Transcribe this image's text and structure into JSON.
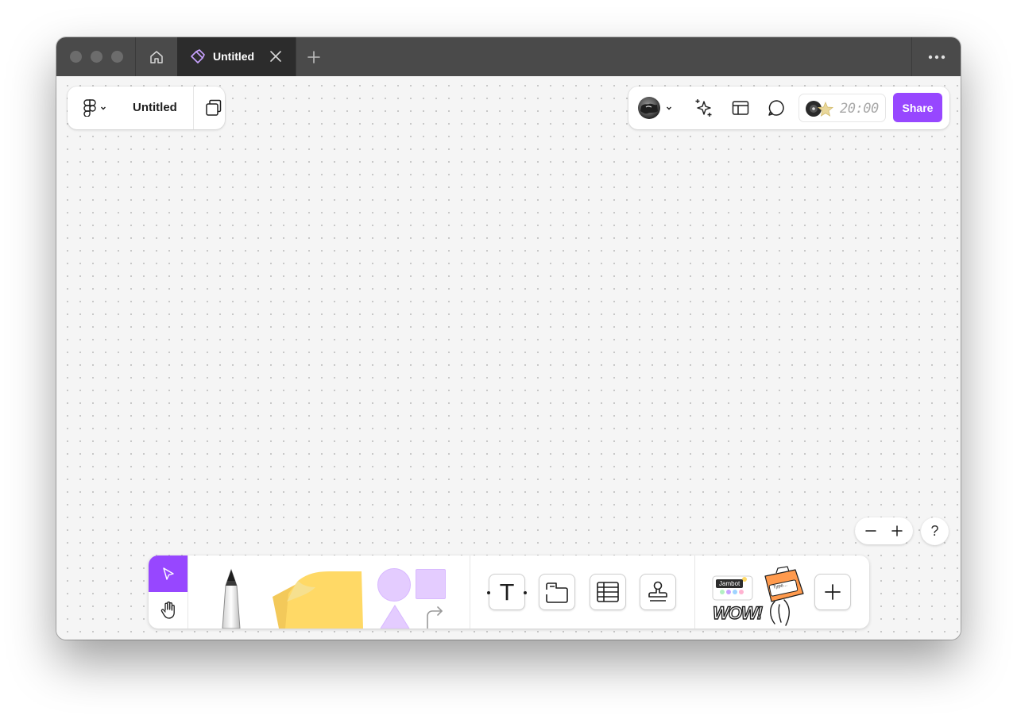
{
  "window": {
    "tabs": [
      {
        "label": "Untitled",
        "active": true
      }
    ]
  },
  "file_menu": {
    "file_name": "Untitled"
  },
  "toolbar_right": {
    "timer": "20:00",
    "share_label": "Share"
  },
  "zoom": {
    "help_label": "?"
  },
  "bottom_toolbar": {
    "text_tool_glyph": "T",
    "widget_badge": "Jambot",
    "widget_caption": "WOW!",
    "plugin_caption": "Type..."
  },
  "colors": {
    "accent": "#9747ff",
    "titlebar": "#4a4a4a",
    "tab_active": "#2c2c2c",
    "canvas": "#f5f5f5",
    "sticky": "#ffd966",
    "shape": "#e4ccff"
  },
  "icons": {
    "home": "home-icon",
    "tab": "figjam-file-icon",
    "close": "close-icon",
    "new_tab": "plus-icon",
    "more": "more-icon",
    "logo": "figma-logo-icon",
    "pages": "pages-icon",
    "ai": "ai-sparkle-icon",
    "layout": "layout-icon",
    "comment": "comment-icon",
    "zoom_out": "minus-icon",
    "zoom_in": "plus-icon",
    "move": "cursor-icon",
    "hand": "hand-icon",
    "section": "section-icon",
    "table": "table-icon",
    "stamp": "stamp-icon",
    "add": "plus-icon"
  }
}
